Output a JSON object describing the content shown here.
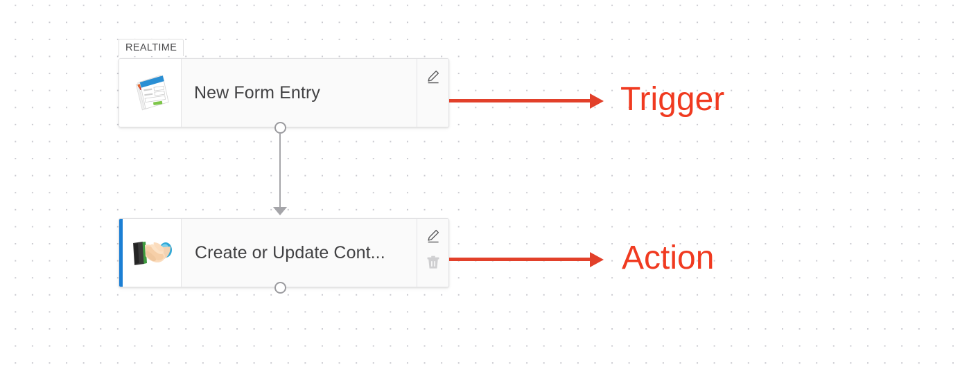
{
  "canvas": {
    "background_color": "#ffffff",
    "dot_color": "#c9c9cf"
  },
  "nodes": [
    {
      "id": "trigger-node",
      "badge": "REALTIME",
      "title": "New Form Entry",
      "icon_name": "form-stack-icon",
      "accent_color": "none",
      "tools": [
        {
          "name": "edit-icon",
          "label": "Edit"
        }
      ]
    },
    {
      "id": "action-node",
      "badge": "",
      "title": "Create or Update Cont...",
      "icon_name": "handshake-icon",
      "accent_color": "#1b7fd4",
      "tools": [
        {
          "name": "edit-icon",
          "label": "Edit"
        },
        {
          "name": "trash-icon",
          "label": "Delete"
        }
      ]
    }
  ],
  "annotations": [
    {
      "name": "trigger-annotation",
      "label": "Trigger",
      "color": "#f03a20"
    },
    {
      "name": "action-annotation",
      "label": "Action",
      "color": "#f03a20"
    }
  ],
  "connector": {
    "color": "#a5a5a9",
    "from": "trigger-node",
    "to": "action-node"
  }
}
